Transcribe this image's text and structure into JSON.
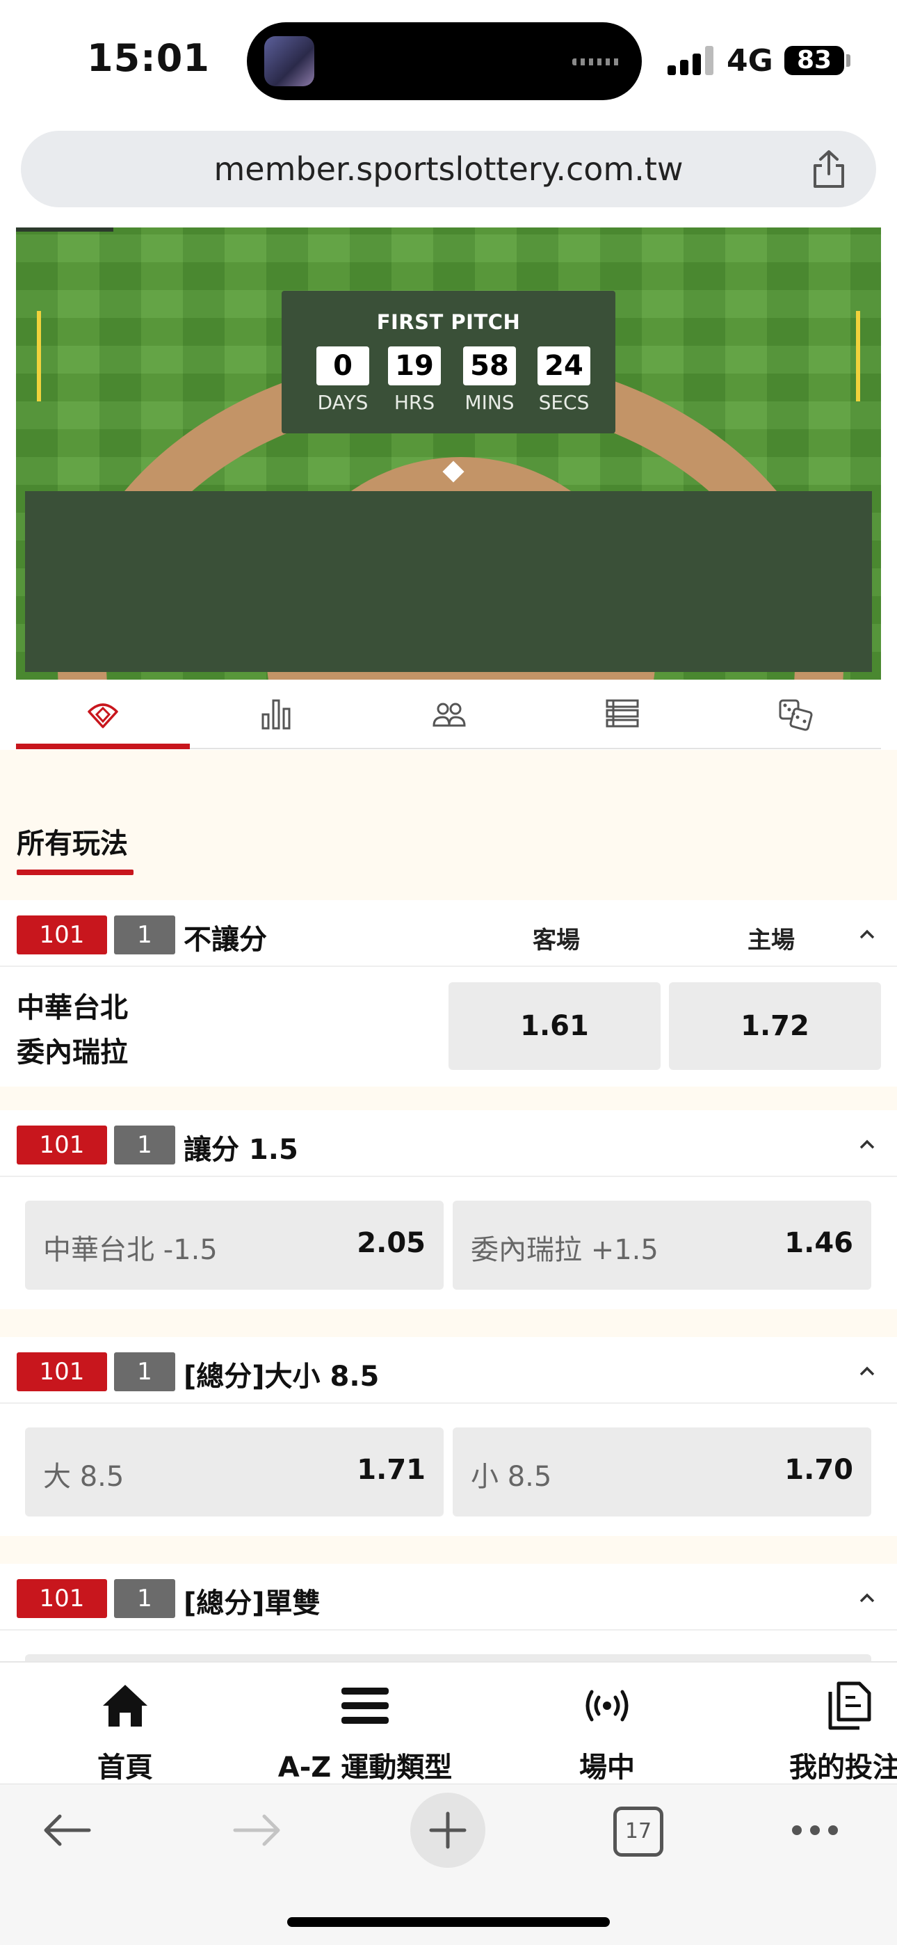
{
  "status_bar": {
    "time": "15:01",
    "network": "4G",
    "battery": "83"
  },
  "browser": {
    "url": "member.sportslottery.com.tw",
    "tab_count": "17"
  },
  "countdown": {
    "title": "FIRST PITCH",
    "units": [
      {
        "value": "0",
        "label": "DAYS"
      },
      {
        "value": "19",
        "label": "HRS"
      },
      {
        "value": "58",
        "label": "MINS"
      },
      {
        "value": "24",
        "label": "SECS"
      }
    ]
  },
  "tabs": [
    {
      "icon": "baseball-field-icon",
      "active": true
    },
    {
      "icon": "stats-bar-icon",
      "active": false
    },
    {
      "icon": "players-icon",
      "active": false
    },
    {
      "icon": "lineup-list-icon",
      "active": false
    },
    {
      "icon": "dice-icon",
      "active": false
    }
  ],
  "all_plays_label": "所有玩法",
  "markets": [
    {
      "code": "101",
      "num": "1",
      "title": "不讓分",
      "col_away": "客場",
      "col_home": "主場",
      "team_away": "中華台北",
      "team_home": "委內瑞拉",
      "odds_away": "1.61",
      "odds_home": "1.72"
    },
    {
      "code": "101",
      "num": "1",
      "title": "讓分 1.5",
      "left_label": "中華台北 -1.5",
      "left_odds": "2.05",
      "right_label": "委內瑞拉 +1.5",
      "right_odds": "1.46"
    },
    {
      "code": "101",
      "num": "1",
      "title": "[總分]大小 8.5",
      "left_label": "大 8.5",
      "left_odds": "1.71",
      "right_label": "小 8.5",
      "right_odds": "1.70"
    },
    {
      "code": "101",
      "num": "1",
      "title": "[總分]單雙"
    }
  ],
  "bottom_nav": [
    {
      "label": "首頁",
      "icon": "home-icon"
    },
    {
      "label": "A-Z 運動類型",
      "icon": "menu-icon"
    },
    {
      "label": "場中",
      "icon": "live-broadcast-icon"
    },
    {
      "label": "我的投注",
      "icon": "my-bets-icon"
    }
  ],
  "colors": {
    "accent_red": "#c8161d",
    "badge_gray": "#6b6b6b",
    "field_green": "#5ea03e",
    "panel_green": "#3a5038"
  }
}
